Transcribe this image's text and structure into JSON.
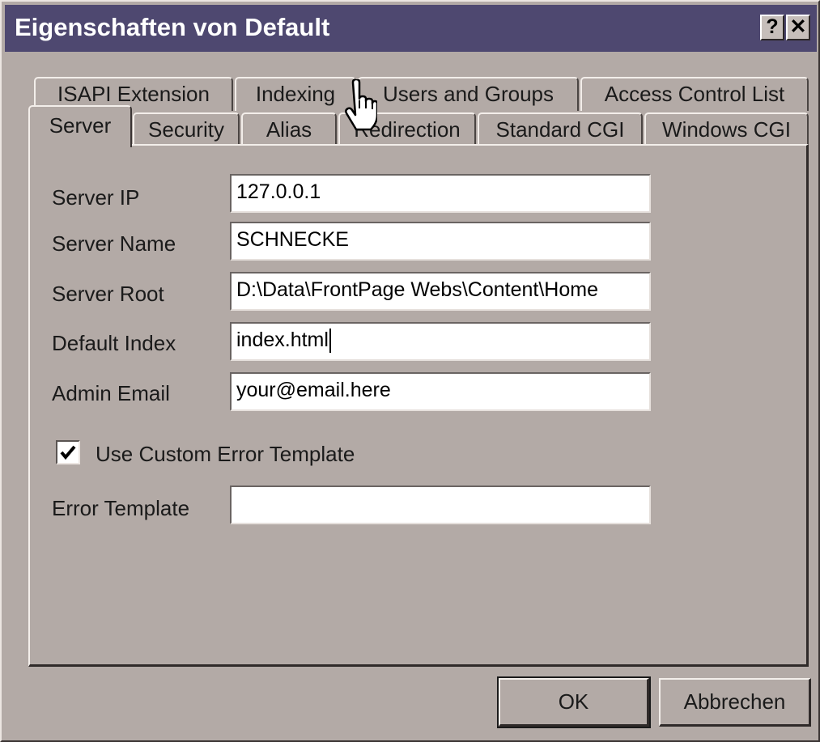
{
  "window": {
    "title": "Eigenschaften von Default",
    "help_label": "?",
    "close_label": "✕"
  },
  "tabs_back": [
    {
      "label": "ISAPI Extension"
    },
    {
      "label": "Indexing"
    },
    {
      "label": "Users and Groups"
    },
    {
      "label": "Access Control List"
    }
  ],
  "tabs_front": [
    {
      "label": "Server"
    },
    {
      "label": "Security"
    },
    {
      "label": "Alias"
    },
    {
      "label": "Redirection"
    },
    {
      "label": "Standard CGI"
    },
    {
      "label": "Windows CGI"
    }
  ],
  "active_tab": "Server",
  "fields": {
    "server_ip": {
      "label": "Server IP",
      "value": "127.0.0.1"
    },
    "server_name": {
      "label": "Server Name",
      "value": "SCHNECKE"
    },
    "server_root": {
      "label": "Server Root",
      "value": "D:\\Data\\FrontPage Webs\\Content\\Home"
    },
    "default_index": {
      "label": "Default Index",
      "value": "index.html"
    },
    "admin_email": {
      "label": "Admin Email",
      "value": "your@email.here"
    },
    "error_template": {
      "label": "Error Template",
      "value": ""
    }
  },
  "custom_error": {
    "label": "Use Custom Error Template",
    "checked": true
  },
  "buttons": {
    "ok": "OK",
    "cancel": "Abbrechen"
  },
  "colors": {
    "titlebar": "#4e4870",
    "face": "#b3aaa6"
  },
  "icons": [
    "help-icon",
    "close-icon",
    "checkmark-icon",
    "hand-pointer-cursor-icon"
  ]
}
